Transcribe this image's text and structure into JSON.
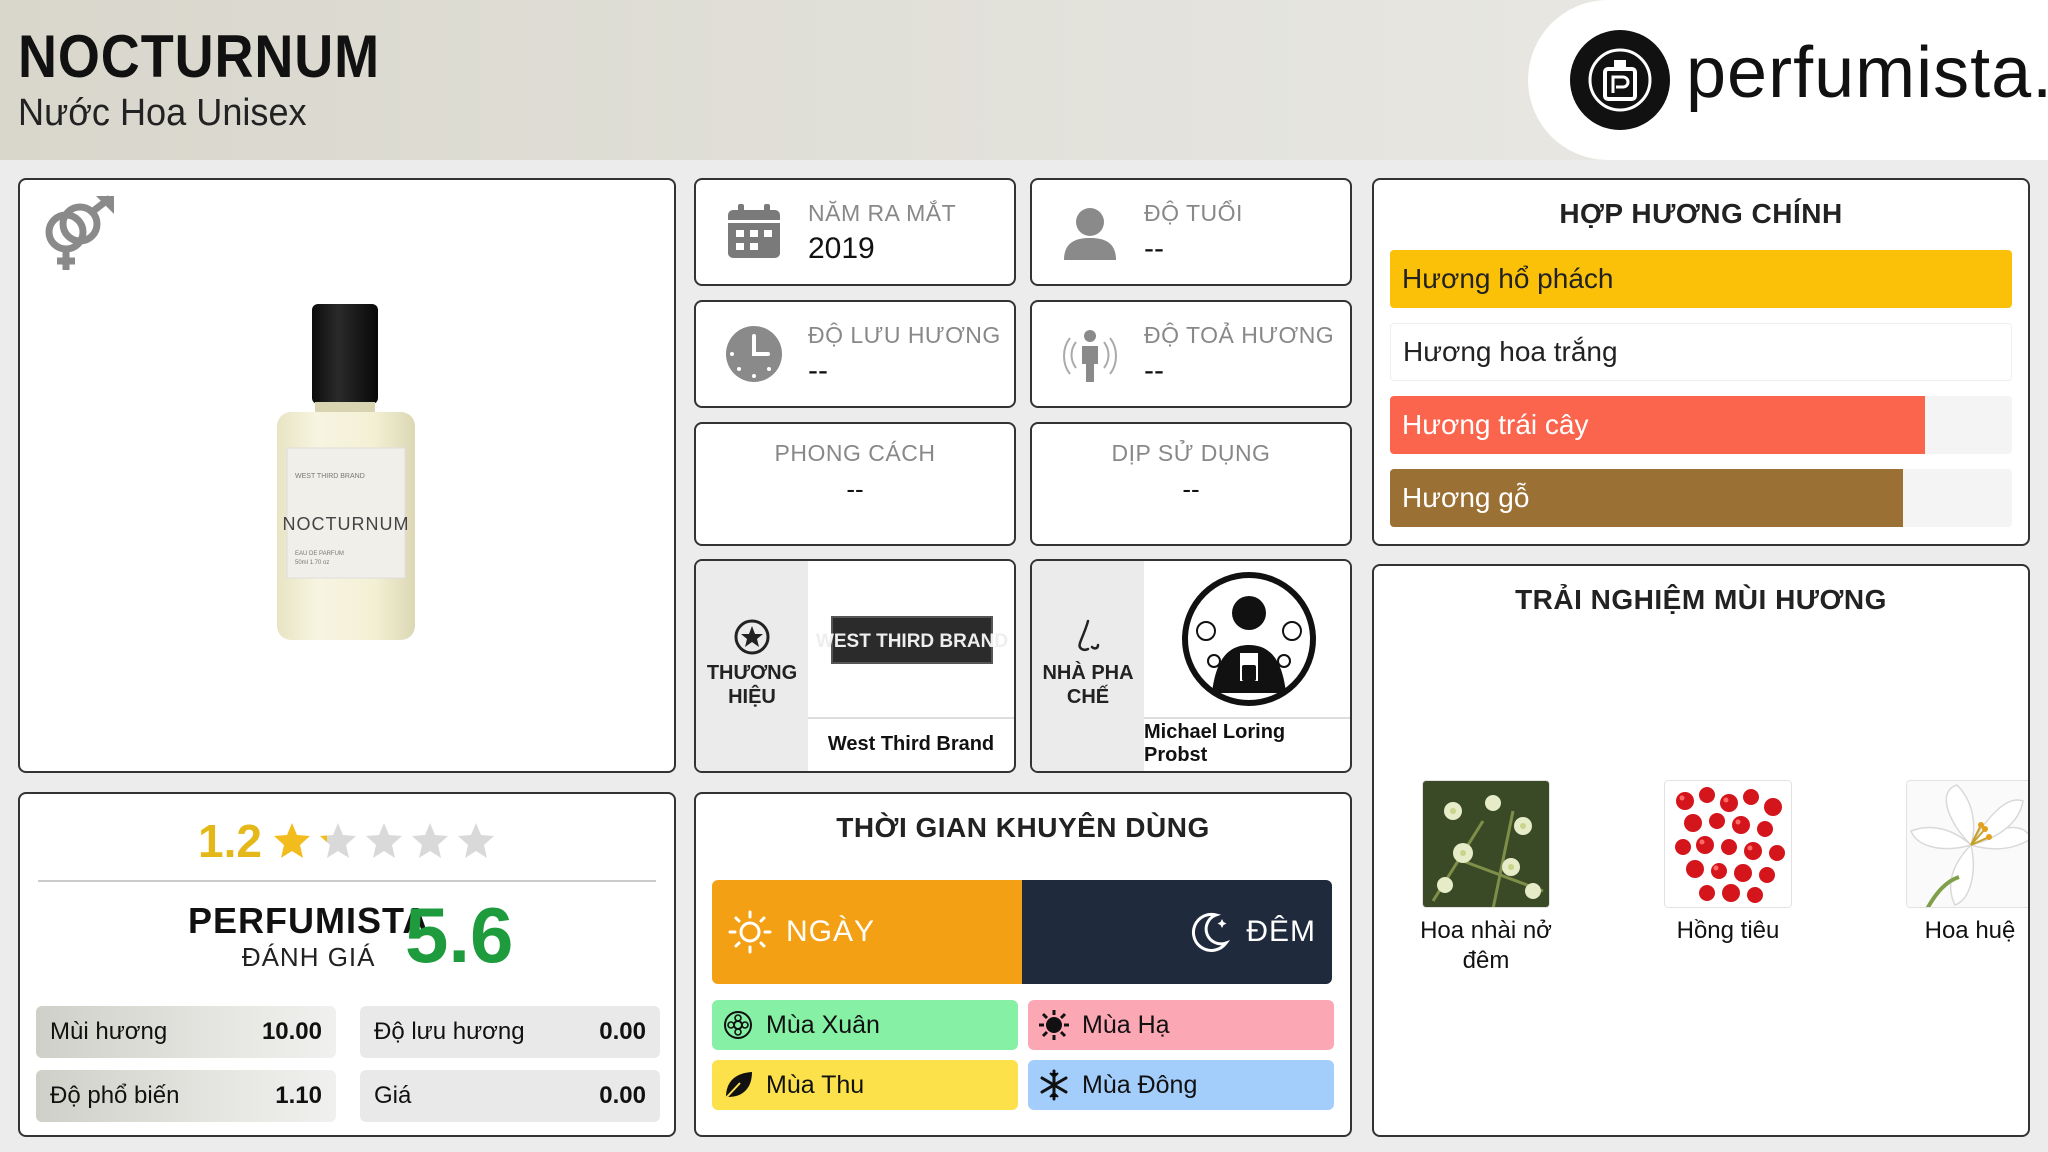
{
  "header": {
    "title": "NOCTURNUM",
    "subtitle": "Nước Hoa Unisex",
    "logo_text": "perfumista.vn"
  },
  "product": {
    "bottle_brand": "WEST THIRD BRAND",
    "bottle_name": "NOCTURNUM",
    "bottle_sub": "EAU DE PARFUM",
    "bottle_size": "50ml 1.70 oz"
  },
  "rating": {
    "value": "1.2",
    "stars_filled_fraction": 0.24,
    "pf_line1": "PERFUMISTA",
    "pf_line2": "ĐÁNH GIÁ",
    "pf_score": "5.6",
    "metrics": [
      {
        "label": "Mùi hương",
        "value": "10.00"
      },
      {
        "label": "Độ lưu hương",
        "value": "0.00"
      },
      {
        "label": "Độ phổ biến",
        "value": "1.10"
      },
      {
        "label": "Giá",
        "value": "0.00"
      }
    ]
  },
  "info": {
    "launch": {
      "label": "NĂM RA MẮT",
      "value": "2019"
    },
    "age": {
      "label": "ĐỘ TUỔI",
      "value": "--"
    },
    "longevity": {
      "label": "ĐỘ LƯU HƯƠNG",
      "value": "--"
    },
    "sillage": {
      "label": "ĐỘ TOẢ HƯƠNG",
      "value": "--"
    },
    "style": {
      "label": "PHONG CÁCH",
      "value": "--"
    },
    "occasion": {
      "label": "DỊP SỬ DỤNG",
      "value": "--"
    }
  },
  "brand": {
    "side_label": "THƯƠNG HIỆU",
    "logo_text": "WEST THIRD BRAND",
    "name": "West Third Brand"
  },
  "perfumer": {
    "side_label": "NHÀ PHA CHẾ",
    "name": "Michael Loring Probst"
  },
  "accords": {
    "title": "HỢP HƯƠNG CHÍNH",
    "items": [
      {
        "label": "Hương hổ phách",
        "level": 1.0,
        "color": "#fbc108",
        "text_color": "#222222"
      },
      {
        "label": "Hương hoa trắng",
        "level": 1.0,
        "color": "#ffffff",
        "text_color": "#222222"
      },
      {
        "label": "Hương trái cây",
        "level": 0.86,
        "color": "#fb654d",
        "text_color": "#ffffff"
      },
      {
        "label": "Hương gỗ",
        "level": 0.825,
        "color": "#9b7034",
        "text_color": "#ffffff"
      }
    ]
  },
  "timing": {
    "title": "THỜI GIAN KHUYÊN DÙNG",
    "day": "NGÀY",
    "night": "ĐÊM",
    "day_fraction": 0.5,
    "seasons": [
      {
        "label": "Mùa Xuân",
        "color": "#86f0a5"
      },
      {
        "label": "Mùa Hạ",
        "color": "#fca8b4"
      },
      {
        "label": "Mùa Thu",
        "color": "#fde14a"
      },
      {
        "label": "Mùa Đông",
        "color": "#a3cdfb"
      }
    ]
  },
  "notes": {
    "title": "TRẢI NGHIỆM MÙI HƯƠNG",
    "items": [
      {
        "label": "Hoa nhài nở đêm"
      },
      {
        "label": "Hồng tiêu"
      },
      {
        "label": "Hoa huệ"
      }
    ]
  }
}
